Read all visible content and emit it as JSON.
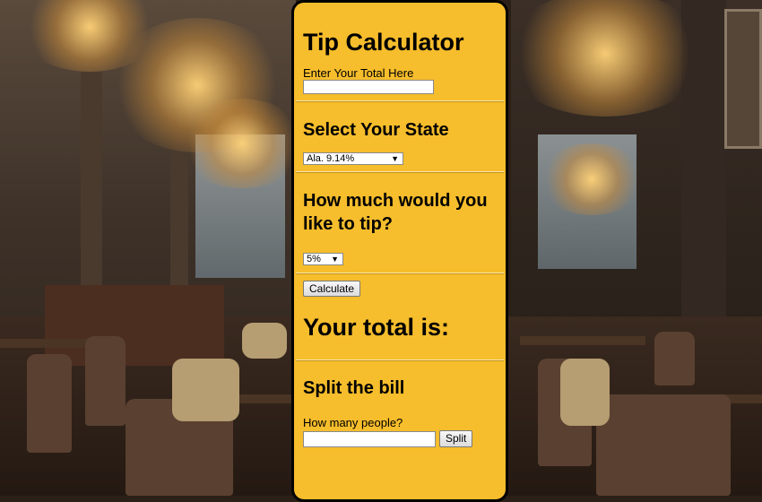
{
  "calculator": {
    "title": "Tip Calculator",
    "total_label": "Enter Your Total Here",
    "total_value": "",
    "state_heading": "Select Your State",
    "state_selected": "Ala. 9.14%",
    "tip_heading": "How much would you like to tip?",
    "tip_selected": "5%",
    "calculate_label": "Calculate",
    "result_heading": "Your total is:",
    "split_heading": "Split the bill",
    "people_label": "How many people?",
    "people_value": "",
    "split_label": "Split"
  },
  "theme": {
    "panel_color": "#f6bd2c",
    "border_color": "#000000"
  },
  "icons": {
    "dropdown_arrow": "chevron-down-icon"
  }
}
